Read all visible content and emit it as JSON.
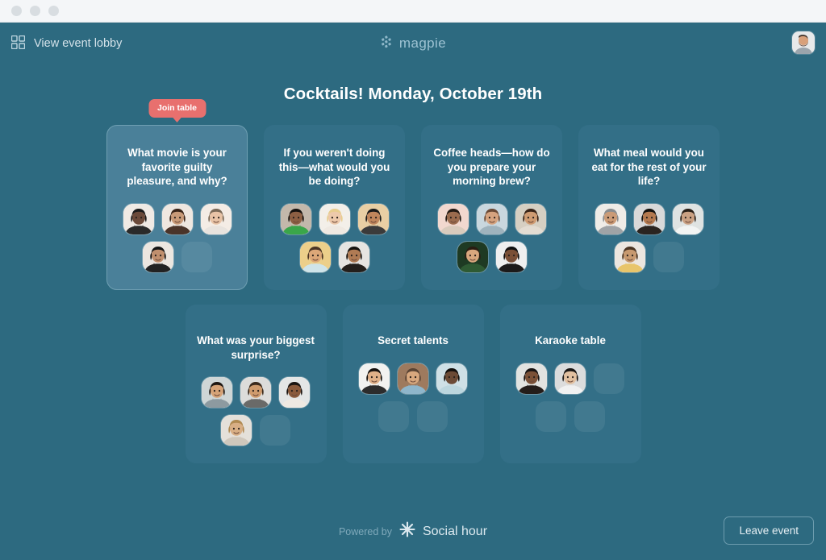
{
  "window": {
    "traffic_lights": 3
  },
  "header": {
    "lobby_label": "View event lobby",
    "lobby_icon": "grid-icon",
    "brand_name": "magpie",
    "brand_icon": "magpie-flower-icon",
    "user_avatar_icon": "user-avatar"
  },
  "event": {
    "title": "Cocktails! Monday, October 19th"
  },
  "tooltip": {
    "join_label": "Join table",
    "color": "#e8706e"
  },
  "colors": {
    "background": "#2d6a80",
    "card": "#336f87",
    "card_active": "#4a8099",
    "accent": "#e8706e",
    "text": "#ffffff",
    "muted": "#9dc2d2"
  },
  "tables": [
    {
      "question": "What movie is your favorite guilty pleasure, and why?",
      "active": true,
      "seats": [
        {
          "state": "filled",
          "avatar": "woman-short-dark-hair"
        },
        {
          "state": "filled",
          "avatar": "woman-long-brown-hair"
        },
        {
          "state": "filled",
          "avatar": "woman-blonde-bob"
        },
        {
          "state": "filled",
          "avatar": "woman-glasses-dark-hair"
        },
        {
          "state": "empty",
          "avatar": ""
        }
      ]
    },
    {
      "question": "If you weren't doing this—what would you be doing?",
      "active": false,
      "seats": [
        {
          "state": "filled",
          "avatar": "man-green-shirt"
        },
        {
          "state": "filled",
          "avatar": "woman-curly-blonde"
        },
        {
          "state": "filled",
          "avatar": "man-glasses"
        },
        {
          "state": "filled",
          "avatar": "man-smiling-yellow-bg"
        },
        {
          "state": "filled",
          "avatar": "man-beard-dark"
        }
      ]
    },
    {
      "question": "Coffee heads—how do you prepare your morning brew?",
      "active": false,
      "seats": [
        {
          "state": "filled",
          "avatar": "person-pink-bg"
        },
        {
          "state": "filled",
          "avatar": "man-light-shirt"
        },
        {
          "state": "filled",
          "avatar": "woman-long-wavy-hair"
        },
        {
          "state": "filled",
          "avatar": "man-greenery-bg"
        },
        {
          "state": "filled",
          "avatar": "woman-curly-black-hair"
        }
      ]
    },
    {
      "question": "What meal would you eat for the rest of your life?",
      "active": false,
      "seats": [
        {
          "state": "filled",
          "avatar": "woman-headscarf"
        },
        {
          "state": "filled",
          "avatar": "man-dark-hair-beard"
        },
        {
          "state": "filled",
          "avatar": "person-lab-coat"
        },
        {
          "state": "filled",
          "avatar": "woman-head-wrap"
        },
        {
          "state": "empty",
          "avatar": ""
        }
      ]
    },
    {
      "question": "What was your biggest surprise?",
      "active": false,
      "seats": [
        {
          "state": "filled",
          "avatar": "boy-dark-hair"
        },
        {
          "state": "filled",
          "avatar": "man-smiling-beard"
        },
        {
          "state": "filled",
          "avatar": "woman-short-hair-smiling"
        },
        {
          "state": "filled",
          "avatar": "person-curly-hair"
        },
        {
          "state": "empty",
          "avatar": ""
        }
      ]
    },
    {
      "question": "Secret talents",
      "active": false,
      "seats": [
        {
          "state": "filled",
          "avatar": "man-glasses-smiling"
        },
        {
          "state": "filled",
          "avatar": "man-blue-shirt"
        },
        {
          "state": "filled",
          "avatar": "man-light-blue-tshirt"
        },
        {
          "state": "empty",
          "avatar": ""
        },
        {
          "state": "empty",
          "avatar": ""
        }
      ]
    },
    {
      "question": "Karaoke table",
      "active": false,
      "seats": [
        {
          "state": "filled",
          "avatar": "woman-braids"
        },
        {
          "state": "filled",
          "avatar": "man-white-shirt"
        },
        {
          "state": "empty",
          "avatar": ""
        },
        {
          "state": "empty",
          "avatar": ""
        },
        {
          "state": "empty",
          "avatar": ""
        }
      ]
    }
  ],
  "footer": {
    "powered_by": "Powered by",
    "product_name": "Social hour",
    "product_icon": "starburst-icon",
    "leave_label": "Leave event"
  }
}
